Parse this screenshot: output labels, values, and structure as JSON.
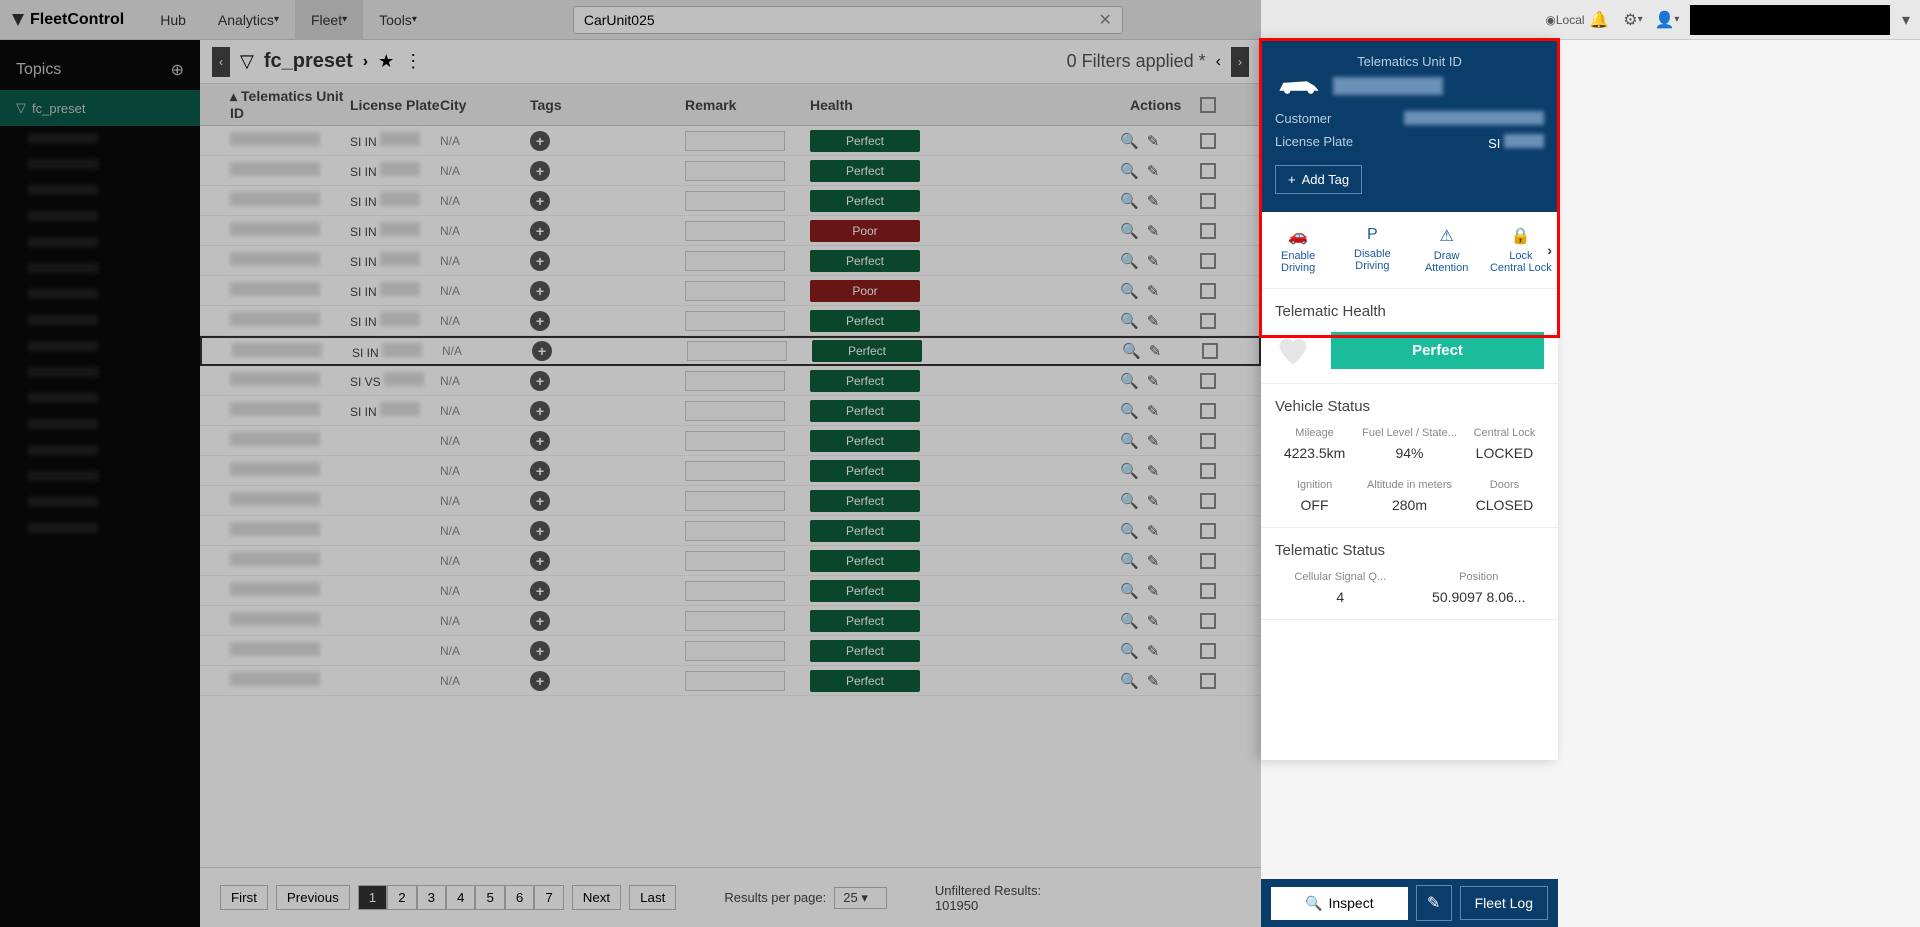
{
  "header": {
    "logo": "FleetControl",
    "nav": [
      "Hub",
      "Analytics",
      "Fleet",
      "Tools"
    ],
    "active_nav": 2,
    "search_value": "CarUnit025",
    "local_label": "Local"
  },
  "sidebar": {
    "title": "Topics",
    "active_item": "fc_preset",
    "subs": [
      "",
      "",
      "",
      "",
      "",
      "",
      "",
      "",
      "",
      "",
      "",
      "",
      "",
      "",
      "",
      ""
    ]
  },
  "toolbar": {
    "preset": "fc_preset",
    "filters_text": "0 Filters applied *"
  },
  "columns": [
    "Telematics Unit ID",
    "License Plate",
    "City",
    "Tags",
    "Remark",
    "Health",
    "Actions"
  ],
  "rows": [
    {
      "lp": "SI IN",
      "city": "N/A",
      "health": "Perfect"
    },
    {
      "lp": "SI IN",
      "city": "N/A",
      "health": "Perfect"
    },
    {
      "lp": "SI IN",
      "city": "N/A",
      "health": "Perfect"
    },
    {
      "lp": "SI IN",
      "city": "N/A",
      "health": "Poor"
    },
    {
      "lp": "SI IN",
      "city": "N/A",
      "health": "Perfect"
    },
    {
      "lp": "SI IN",
      "city": "N/A",
      "health": "Poor"
    },
    {
      "lp": "SI IN",
      "city": "N/A",
      "health": "Perfect"
    },
    {
      "lp": "SI IN",
      "city": "N/A",
      "health": "Perfect",
      "selected": true
    },
    {
      "lp": "SI VS",
      "city": "N/A",
      "health": "Perfect"
    },
    {
      "lp": "SI IN",
      "city": "N/A",
      "health": "Perfect"
    },
    {
      "lp": "",
      "city": "N/A",
      "health": "Perfect"
    },
    {
      "lp": "",
      "city": "N/A",
      "health": "Perfect"
    },
    {
      "lp": "",
      "city": "N/A",
      "health": "Perfect"
    },
    {
      "lp": "",
      "city": "N/A",
      "health": "Perfect"
    },
    {
      "lp": "",
      "city": "N/A",
      "health": "Perfect"
    },
    {
      "lp": "",
      "city": "N/A",
      "health": "Perfect"
    },
    {
      "lp": "",
      "city": "N/A",
      "health": "Perfect"
    },
    {
      "lp": "",
      "city": "N/A",
      "health": "Perfect"
    },
    {
      "lp": "",
      "city": "N/A",
      "health": "Perfect"
    }
  ],
  "pager": {
    "first": "First",
    "prev": "Previous",
    "pages": [
      "1",
      "2",
      "3",
      "4",
      "5",
      "6",
      "7"
    ],
    "active": 0,
    "next": "Next",
    "last": "Last",
    "per_page_label": "Results per page:",
    "per_page": "25",
    "unfiltered_label": "Unfiltered Results:",
    "unfiltered": "101950"
  },
  "detail": {
    "title": "Telematics Unit ID",
    "unit_id": "",
    "customer_label": "Customer",
    "customer_value": "",
    "plate_label": "License Plate",
    "plate_value": "SI",
    "add_tag": "Add Tag",
    "actions": [
      {
        "icon": "🚗",
        "l1": "Enable",
        "l2": "Driving"
      },
      {
        "icon": "P",
        "l1": "Disable",
        "l2": "Driving"
      },
      {
        "icon": "⚠",
        "l1": "Draw",
        "l2": "Attention"
      },
      {
        "icon": "🔒",
        "l1": "Lock",
        "l2": "Central Lock"
      }
    ],
    "health_title": "Telematic Health",
    "health_status": "Perfect",
    "vstatus_title": "Vehicle Status",
    "vstatus": [
      {
        "l": "Mileage",
        "v": "4223.5km"
      },
      {
        "l": "Fuel Level / State...",
        "v": "94%"
      },
      {
        "l": "Central Lock",
        "v": "LOCKED"
      },
      {
        "l": "Ignition",
        "v": "OFF"
      },
      {
        "l": "Altitude in meters",
        "v": "280m"
      },
      {
        "l": "Doors",
        "v": "CLOSED"
      }
    ],
    "tstatus_title": "Telematic Status",
    "tstatus": [
      {
        "l": "Cellular Signal Q...",
        "v": "4"
      },
      {
        "l": "Position",
        "v": "50.9097 8.06..."
      }
    ],
    "inspect": "Inspect",
    "fleetlog": "Fleet Log"
  }
}
